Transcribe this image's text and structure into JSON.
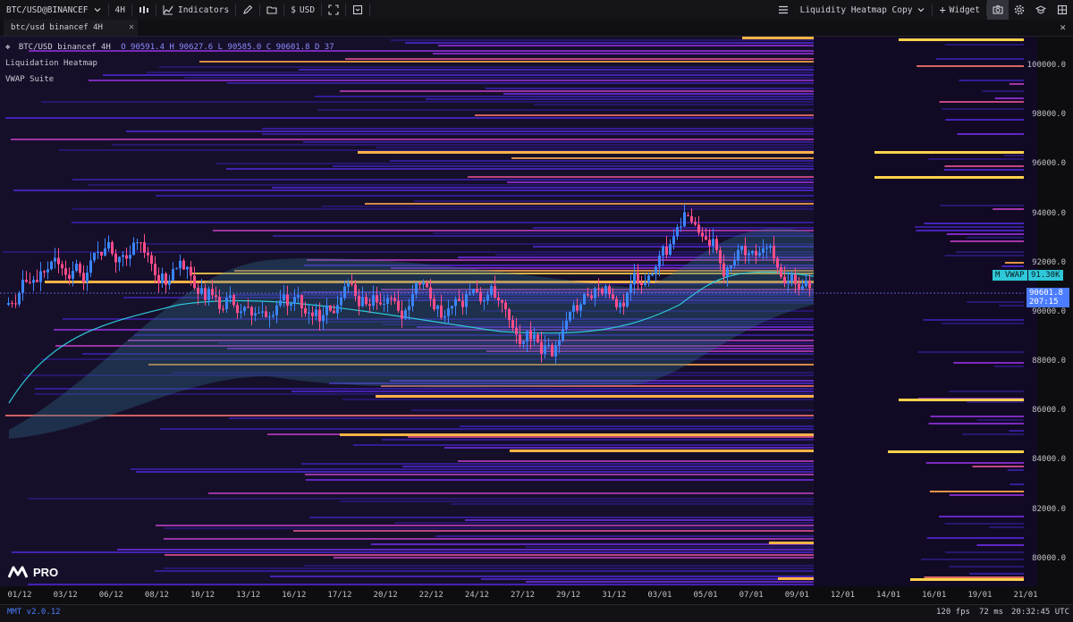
{
  "toolbar": {
    "symbol": "BTC/USD@BINANCEF",
    "timeframe": "4H",
    "indicators_label": "Indicators",
    "currency_label": "USD",
    "layout_name": "Liquidity Heatmap Copy",
    "widget_label": "Widget"
  },
  "tab": {
    "label": "btc/usd binancef 4H"
  },
  "legend": {
    "symbol_line": "BTC/USD binancef 4H",
    "ohlc": "O 90591.4 H 90627.6 L 90585.0 C 90601.8 D 37",
    "indicator_1": "Liquidation Heatmap",
    "indicator_2": "VWAP Suite"
  },
  "price_axis": {
    "ticks": [
      "100000.0",
      "98000.0",
      "96000.0",
      "94000.0",
      "92000.0",
      "90000.0",
      "88000.0",
      "86000.0",
      "84000.0",
      "82000.0",
      "80000.0"
    ],
    "vwap_label": "M VWAP",
    "vwap_value": "91.30K",
    "last_price": "90601.8",
    "countdown": "207:15",
    "range_top": 101200,
    "range_bottom": 78900
  },
  "time_axis": {
    "ticks": [
      "01/12",
      "03/12",
      "06/12",
      "08/12",
      "10/12",
      "13/12",
      "16/12",
      "17/12",
      "20/12",
      "22/12",
      "24/12",
      "27/12",
      "29/12",
      "31/12",
      "03/01",
      "05/01",
      "07/01",
      "09/01",
      "12/01",
      "14/01",
      "16/01",
      "19/01",
      "21/01"
    ]
  },
  "status_bar": {
    "version": "MMT v2.0.12",
    "fps": "120 fps",
    "latency": "72 ms",
    "clock": "20:32:45 UTC"
  },
  "brand": {
    "logo_text": "PRO"
  },
  "colors": {
    "accent": "#4c7cff",
    "vwap_line": "#2ec8d8",
    "candle_up": "#3a86ff",
    "candle_down": "#ff4d8a",
    "heat_low": "#3a1a9a",
    "heat_high": "#ffd24a"
  }
}
